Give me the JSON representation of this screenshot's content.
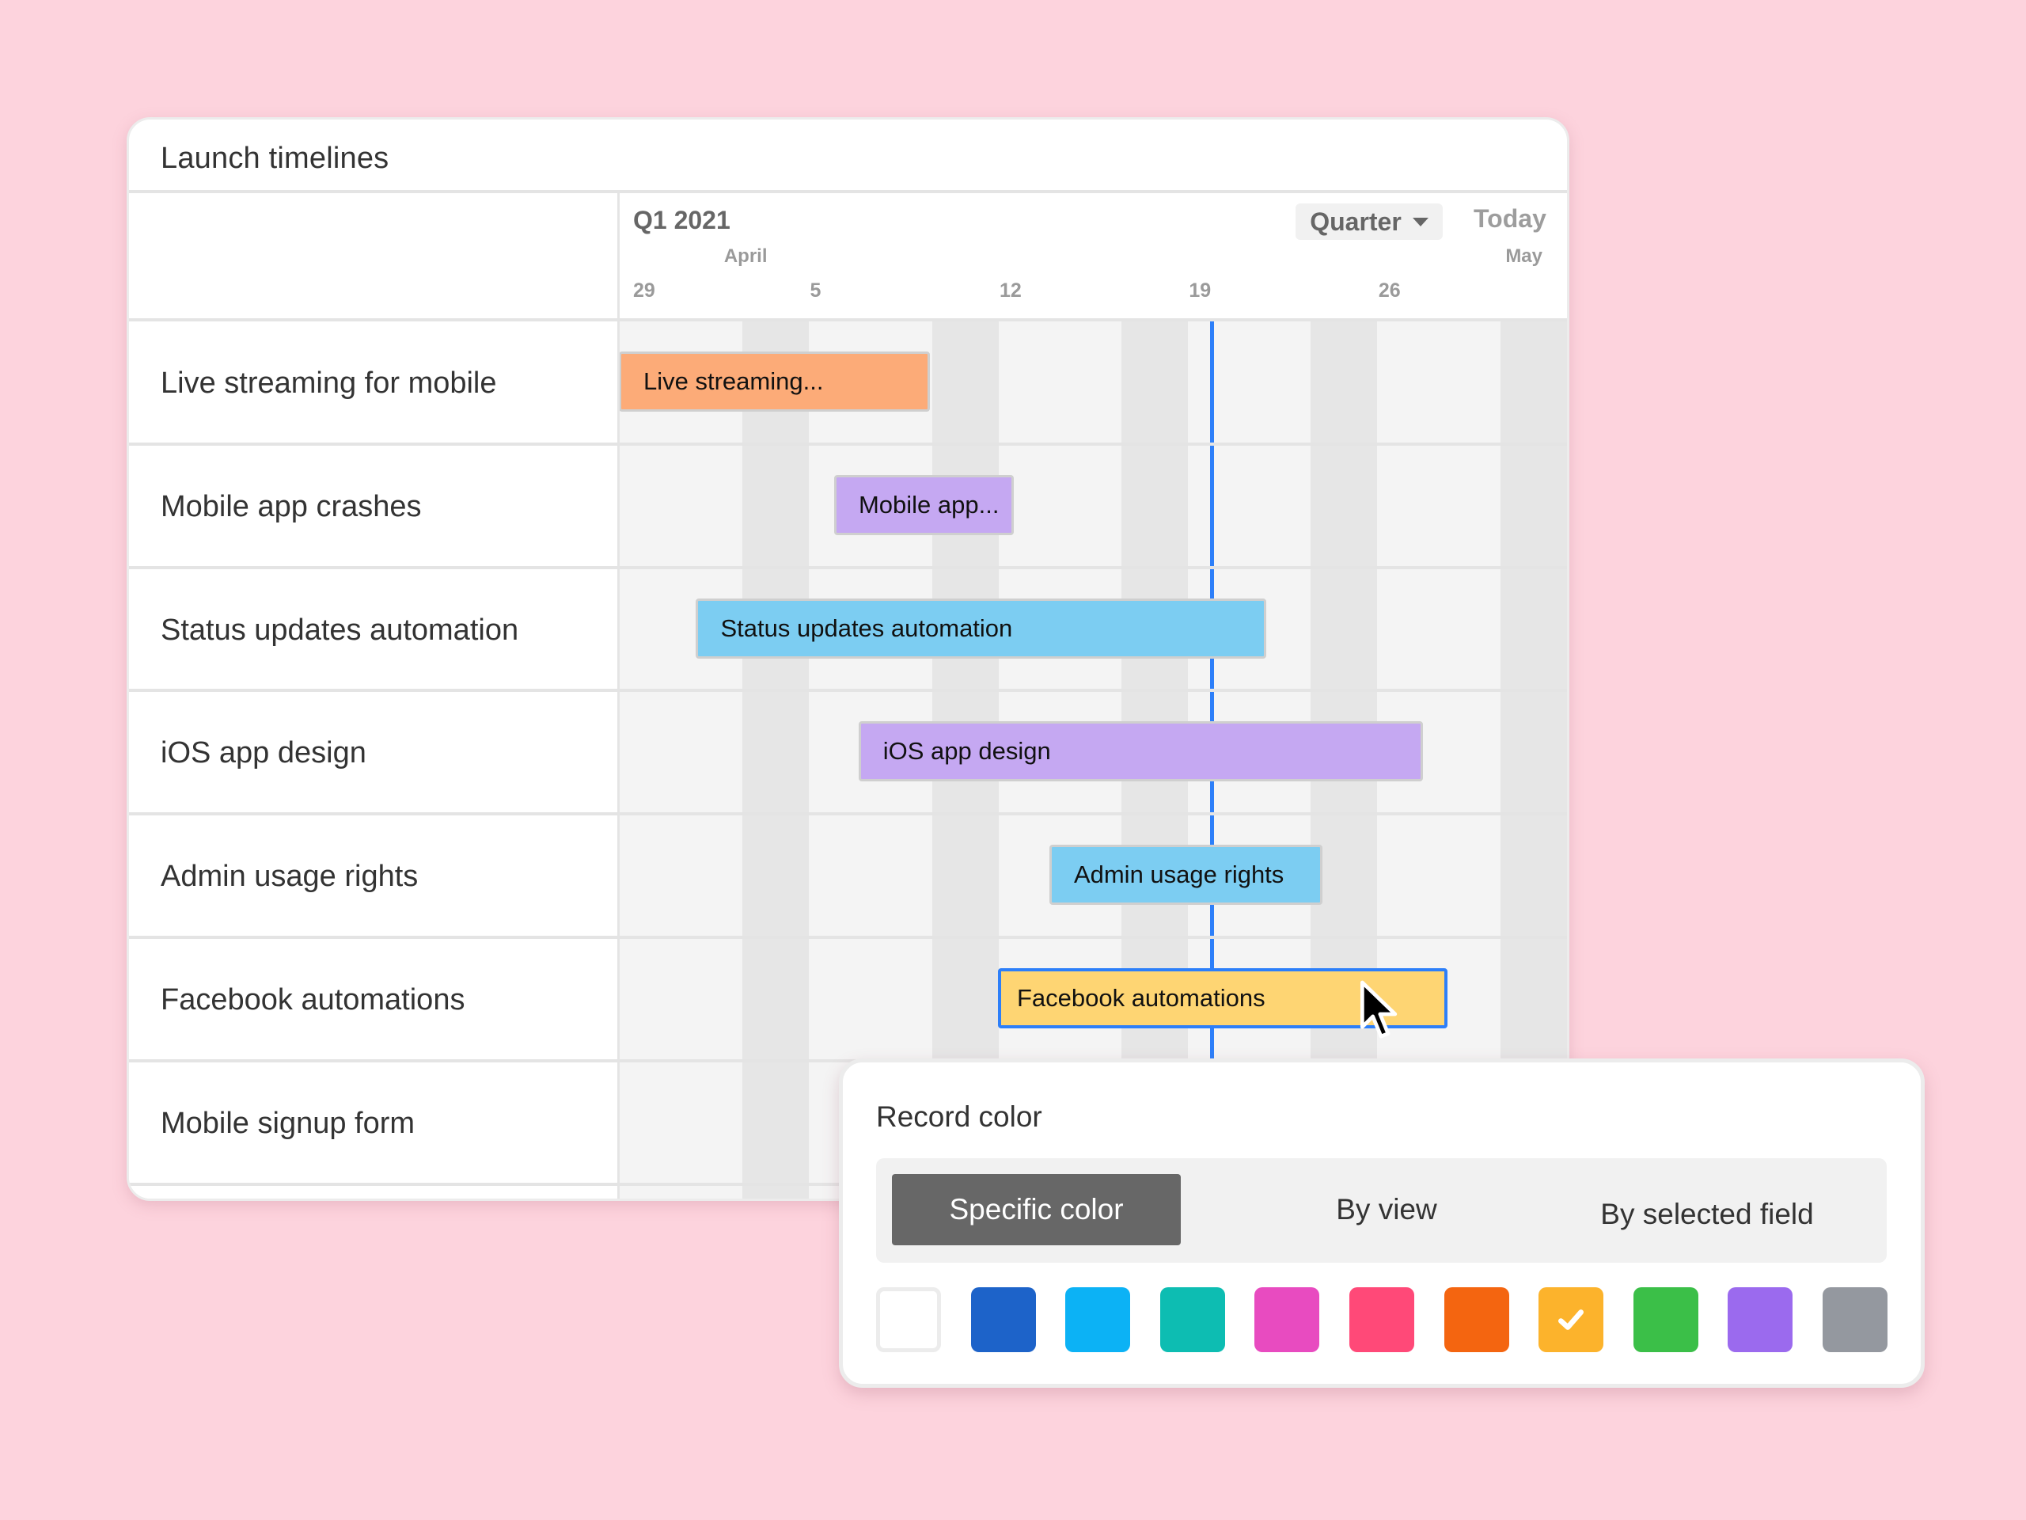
{
  "card": {
    "title": "Launch timelines"
  },
  "timeline": {
    "period_label": "Q1 2021",
    "scale_button": {
      "label": "Quarter",
      "icon": "caret-down-icon"
    },
    "today_button": "Today",
    "months": [
      {
        "label": "April",
        "day": 4
      },
      {
        "label": "May",
        "day": 32
      }
    ],
    "ticks": [
      {
        "label": "29",
        "day": 0
      },
      {
        "label": "5",
        "day": 7
      },
      {
        "label": "12",
        "day": 14
      },
      {
        "label": "19",
        "day": 21
      },
      {
        "label": "26",
        "day": 28
      }
    ],
    "origin_date": "Mar 29",
    "visible_days": 35,
    "today_day": 21.9,
    "today_line_color": "#2d7ff9",
    "weekend_days": [
      5,
      12,
      19,
      26,
      33
    ]
  },
  "records": [
    {
      "name": "Live streaming for mobile",
      "bar_label": "Live streaming...",
      "start_day": 0,
      "end_day": 11.5,
      "color": "#fcab78"
    },
    {
      "name": "Mobile app crashes",
      "bar_label": "Mobile app...",
      "start_day": 7.95,
      "end_day": 14.6,
      "color": "#c5a8f2"
    },
    {
      "name": "Status updates automation",
      "bar_label": "Status updates automation",
      "start_day": 2.85,
      "end_day": 23.9,
      "color": "#7ccdf2"
    },
    {
      "name": "iOS app design",
      "bar_label": "iOS app design",
      "start_day": 8.85,
      "end_day": 29.7,
      "color": "#c5a8f2"
    },
    {
      "name": "Admin usage rights",
      "bar_label": "Admin usage rights",
      "start_day": 15.9,
      "end_day": 26.0,
      "color": "#7ccdf2"
    },
    {
      "name": "Facebook automations",
      "bar_label": "Facebook automations",
      "start_day": 14.0,
      "end_day": 30.6,
      "color": "#fed573",
      "selected": true,
      "selected_border": "#2d7ff9"
    },
    {
      "name": "Mobile signup form",
      "bar_label": "",
      "start_day": null,
      "end_day": null,
      "color": null
    }
  ],
  "popup": {
    "title": "Record color",
    "modes": [
      {
        "label": "Specific color",
        "active": true
      },
      {
        "label": "By view",
        "active": false
      },
      {
        "label": "By selected field",
        "active": false
      }
    ],
    "swatches": [
      {
        "name": "white",
        "color": "#ffffff",
        "selected": false
      },
      {
        "name": "blue",
        "color": "#1d63c9",
        "selected": false
      },
      {
        "name": "cyan",
        "color": "#0cb2f5",
        "selected": false
      },
      {
        "name": "teal",
        "color": "#0dbdb2",
        "selected": false
      },
      {
        "name": "pink",
        "color": "#e84bc0",
        "selected": false
      },
      {
        "name": "red",
        "color": "#ff4978",
        "selected": false
      },
      {
        "name": "orange",
        "color": "#f46510",
        "selected": false
      },
      {
        "name": "yellow",
        "color": "#fcb32c",
        "selected": true
      },
      {
        "name": "green",
        "color": "#3bbf48",
        "selected": false
      },
      {
        "name": "purple",
        "color": "#9b6aee",
        "selected": false
      },
      {
        "name": "gray",
        "color": "#94989f",
        "selected": false
      }
    ]
  },
  "colors": {
    "background": "#fdd3dd",
    "accent": "#2d7ff9"
  }
}
